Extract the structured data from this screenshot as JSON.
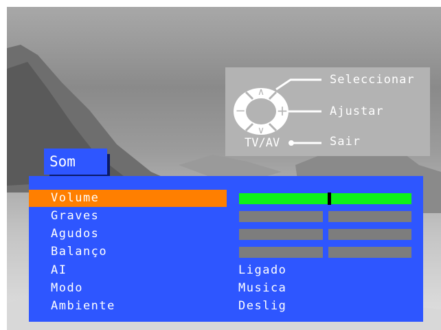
{
  "help": {
    "select_label": "Seleccionar",
    "adjust_label": "Ajustar",
    "exit_label": "Sair",
    "tvav_label": "TV/AV",
    "up_glyph": "∧",
    "down_glyph": "∨",
    "minus_glyph": "−",
    "plus_glyph": "+"
  },
  "menu": {
    "title": "Som",
    "items": [
      {
        "label": "Volume",
        "selected": true,
        "bar_level": 0.52
      },
      {
        "label": "Graves",
        "bar_level": 0.5
      },
      {
        "label": "Agudos",
        "bar_level": 0.5
      },
      {
        "label": "Balanço",
        "bar_level": 0.5
      },
      {
        "label": "AI",
        "value": "Ligado"
      },
      {
        "label": "Modo",
        "value": "Musica"
      },
      {
        "label": "Ambiente",
        "value": "Deslig"
      }
    ]
  },
  "colors": {
    "menu_bg": "#2e56ff",
    "highlight": "#ff7f00",
    "bar_active": "#0ef21a",
    "bar_inactive": "#7d7d7d",
    "help_panel": "#b3b3b3"
  }
}
